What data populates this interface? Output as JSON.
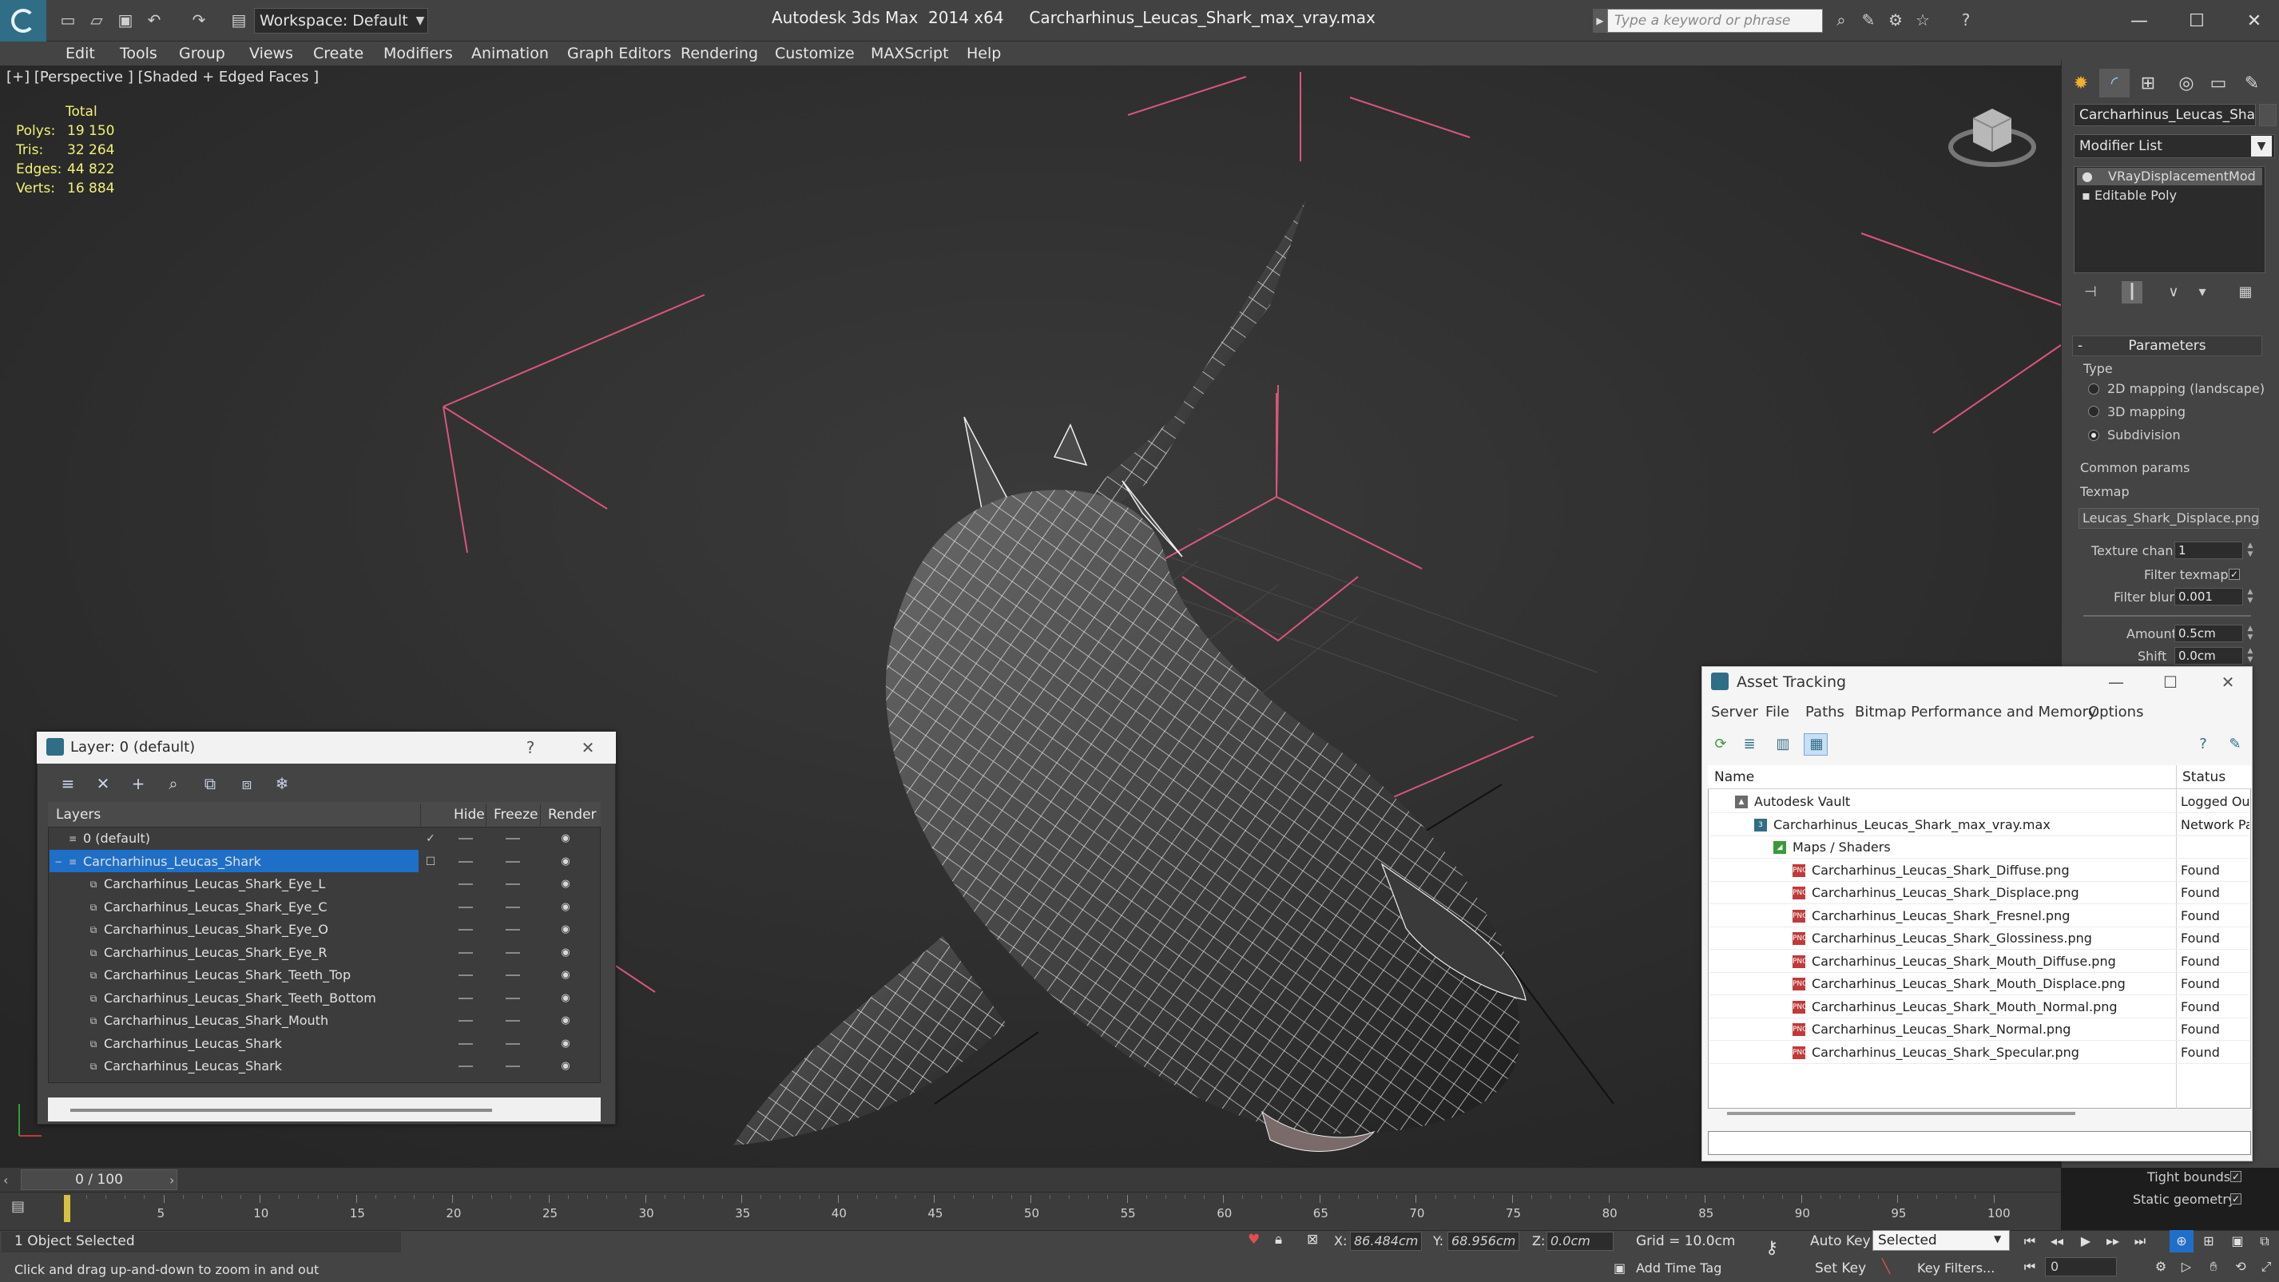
{
  "app": {
    "title": "Autodesk 3ds Max  2014 x64     Carcharhinus_Leucas_Shark_max_vray.max",
    "workspace": "Workspace: Default",
    "search_placeholder": "Type a keyword or phrase"
  },
  "menu": [
    "Edit",
    "Tools",
    "Group",
    "Views",
    "Create",
    "Modifiers",
    "Animation",
    "Graph Editors",
    "Rendering",
    "Customize",
    "MAXScript",
    "Help"
  ],
  "viewport": {
    "label": "[+] [Perspective ] [Shaded + Edged Faces ]",
    "stats": {
      "total_label": "Total",
      "rows": [
        {
          "label": "Polys:",
          "value": "19 150"
        },
        {
          "label": "Tris:",
          "value": "32 264"
        },
        {
          "label": "Edges:",
          "value": "44 822"
        },
        {
          "label": "Verts:",
          "value": "16 884"
        }
      ]
    }
  },
  "command_panel": {
    "object_name": "Carcharhinus_Leucas_Shark",
    "modifier_list": "Modifier List",
    "stack": [
      "VRayDisplacementMod",
      "Editable Poly"
    ],
    "parameters": {
      "header": "Parameters",
      "type_label": "Type",
      "type_options": [
        "2D mapping (landscape)",
        "3D mapping",
        "Subdivision"
      ],
      "selected_type": "Subdivision",
      "common_params": "Common params",
      "texmap_label": "Texmap",
      "texmap_value": "Leucas_Shark_Displace.png)",
      "texture_chan_label": "Texture chan",
      "texture_chan_value": "1",
      "filter_texmap_label": "Filter texmap",
      "filter_blur_label": "Filter blur",
      "filter_blur_value": "0.001",
      "amount_label": "Amount",
      "amount_value": "0.5cm",
      "shift_label": "Shift",
      "shift_value": "0.0cm",
      "tight_bounds_label": "Tight bounds",
      "static_geometry_label": "Static geometry"
    }
  },
  "layer_dialog": {
    "title": "Layer: 0 (default)",
    "columns": [
      "Layers",
      "Hide",
      "Freeze",
      "Render"
    ],
    "rows": [
      {
        "name": "0 (default)",
        "indent": 0,
        "kind": "layer",
        "current": true
      },
      {
        "name": "Carcharhinus_Leucas_Shark",
        "indent": 0,
        "kind": "layer",
        "selected": true
      },
      {
        "name": "Carcharhinus_Leucas_Shark_Eye_L",
        "indent": 1,
        "kind": "object"
      },
      {
        "name": "Carcharhinus_Leucas_Shark_Eye_C",
        "indent": 1,
        "kind": "object"
      },
      {
        "name": "Carcharhinus_Leucas_Shark_Eye_O",
        "indent": 1,
        "kind": "object"
      },
      {
        "name": "Carcharhinus_Leucas_Shark_Eye_R",
        "indent": 1,
        "kind": "object"
      },
      {
        "name": "Carcharhinus_Leucas_Shark_Teeth_Top",
        "indent": 1,
        "kind": "object"
      },
      {
        "name": "Carcharhinus_Leucas_Shark_Teeth_Bottom",
        "indent": 1,
        "kind": "object"
      },
      {
        "name": "Carcharhinus_Leucas_Shark_Mouth",
        "indent": 1,
        "kind": "object"
      },
      {
        "name": "Carcharhinus_Leucas_Shark",
        "indent": 1,
        "kind": "object"
      },
      {
        "name": "Carcharhinus_Leucas_Shark",
        "indent": 1,
        "kind": "object"
      }
    ]
  },
  "asset_tracking": {
    "title": "Asset Tracking",
    "menu": [
      "Server",
      "File",
      "Paths",
      "Bitmap Performance and Memory",
      "Options"
    ],
    "columns": [
      "Name",
      "Status"
    ],
    "rows": [
      {
        "name": "Autodesk Vault",
        "status": "Logged Out",
        "indent": 1,
        "icon": "vault"
      },
      {
        "name": "Carcharhinus_Leucas_Shark_max_vray.max",
        "status": "Network Path",
        "indent": 2,
        "icon": "max"
      },
      {
        "name": "Maps / Shaders",
        "status": "",
        "indent": 3,
        "icon": "maps"
      },
      {
        "name": "Carcharhinus_Leucas_Shark_Diffuse.png",
        "status": "Found",
        "indent": 4,
        "icon": "png"
      },
      {
        "name": "Carcharhinus_Leucas_Shark_Displace.png",
        "status": "Found",
        "indent": 4,
        "icon": "png"
      },
      {
        "name": "Carcharhinus_Leucas_Shark_Fresnel.png",
        "status": "Found",
        "indent": 4,
        "icon": "png"
      },
      {
        "name": "Carcharhinus_Leucas_Shark_Glossiness.png",
        "status": "Found",
        "indent": 4,
        "icon": "png"
      },
      {
        "name": "Carcharhinus_Leucas_Shark_Mouth_Diffuse.png",
        "status": "Found",
        "indent": 4,
        "icon": "png"
      },
      {
        "name": "Carcharhinus_Leucas_Shark_Mouth_Displace.png",
        "status": "Found",
        "indent": 4,
        "icon": "png"
      },
      {
        "name": "Carcharhinus_Leucas_Shark_Mouth_Normal.png",
        "status": "Found",
        "indent": 4,
        "icon": "png"
      },
      {
        "name": "Carcharhinus_Leucas_Shark_Normal.png",
        "status": "Found",
        "indent": 4,
        "icon": "png"
      },
      {
        "name": "Carcharhinus_Leucas_Shark_Specular.png",
        "status": "Found",
        "indent": 4,
        "icon": "png"
      }
    ]
  },
  "timeline": {
    "frame_display": "0 / 100",
    "ticks": [
      "5",
      "10",
      "15",
      "20",
      "25",
      "30",
      "35",
      "40",
      "45",
      "50",
      "55",
      "60",
      "65",
      "70",
      "75",
      "80",
      "85",
      "90",
      "95",
      "100"
    ]
  },
  "status": {
    "selection": "1 Object Selected",
    "prompt": "Click and drag up-and-down to zoom in and out",
    "x_label": "X:",
    "x_value": "86.484cm",
    "y_label": "Y:",
    "y_value": "68.956cm",
    "z_label": "Z:",
    "z_value": "0.0cm",
    "grid": "Grid = 10.0cm",
    "auto_key": "Auto Key",
    "set_key": "Set Key",
    "key_filter": "Selected",
    "key_filters": "Key Filters...",
    "add_time_tag": "Add Time Tag",
    "current_frame": "0"
  },
  "colors": {
    "accent": "#1f6fc9",
    "stats_yellow": "#f2f275",
    "viewport_bg": "#303030",
    "wire": "#f0f0f0",
    "light_helper": "#d9567a"
  }
}
